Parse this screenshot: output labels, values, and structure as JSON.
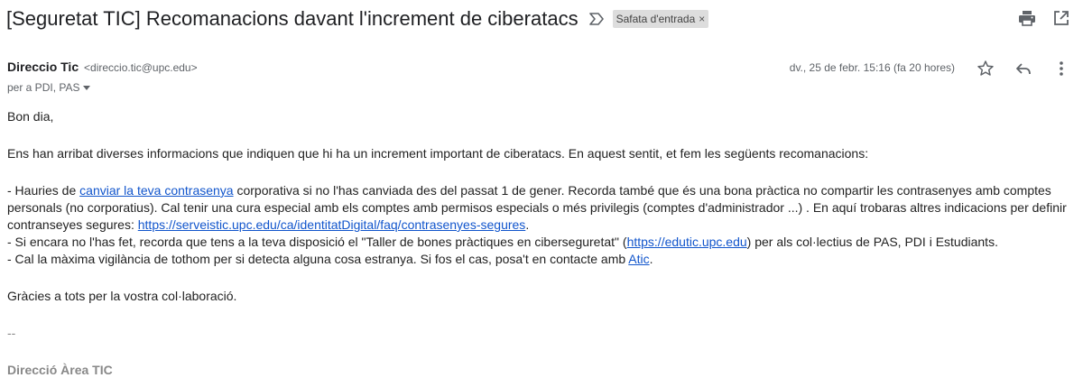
{
  "subject": "[Seguretat TIC] Recomanacions davant l'increment de ciberatacs",
  "label": {
    "text": "Safata d'entrada",
    "close": "×"
  },
  "icons": {
    "importance": "importance-marker-icon",
    "print": "print-icon",
    "open_new_window": "open-in-new-window-icon",
    "star": "star-icon",
    "reply": "reply-icon",
    "more": "more-vertical-icon"
  },
  "sender": {
    "name": "Direccio Tic",
    "email": "<direccio.tic@upc.edu>",
    "recipients": "per a PDI, PAS",
    "date": "dv., 25 de febr. 15:16 (fa 20 hores)"
  },
  "body": {
    "greeting": "Bon dia,",
    "intro": "Ens han arribat diverses informacions que indiquen que hi ha un increment important de ciberatacs. En aquest sentit, et fem les següents recomanacions:",
    "item1_pre": "- Hauries de ",
    "item1_link": "canviar la teva contrasenya",
    "item1_mid": " corporativa si no l'has canviada des del passat 1 de gener. Recorda també que és una bona pràctica no compartir les contrasenyes amb comptes personals (no corporatius). Cal tenir una cura especial amb els comptes amb permisos especials o més privilegis (comptes d'administrador ...) . En aquí trobaras altres indicacions per definir contranseyes segures: ",
    "item1_url": "https://serveistic.upc.edu/ca/identitatDigital/faq/contrasenyes-segures",
    "item1_end": ".",
    "item2_pre": "- Si encara no l'has fet, recorda que tens a la teva disposició el \"Taller de bones pràctiques en ciberseguretat\" (",
    "item2_url": "https://edutic.upc.edu",
    "item2_end": ") per als col·lectius de PAS, PDI i Estudiants.",
    "item3_pre": "- Cal la màxima vigilància de tothom per si detecta alguna cosa estranya. Si fos el cas, posa't en contacte amb ",
    "item3_link": "Atic",
    "item3_end": ".",
    "thanks": "Gràcies a tots per la vostra col·laboració.",
    "sig_dash": "--",
    "sig_name": "Direcció Àrea TIC"
  },
  "colors": {
    "link": "#1155cc",
    "chip_bg": "#dddddd",
    "muted": "#5f6368"
  }
}
